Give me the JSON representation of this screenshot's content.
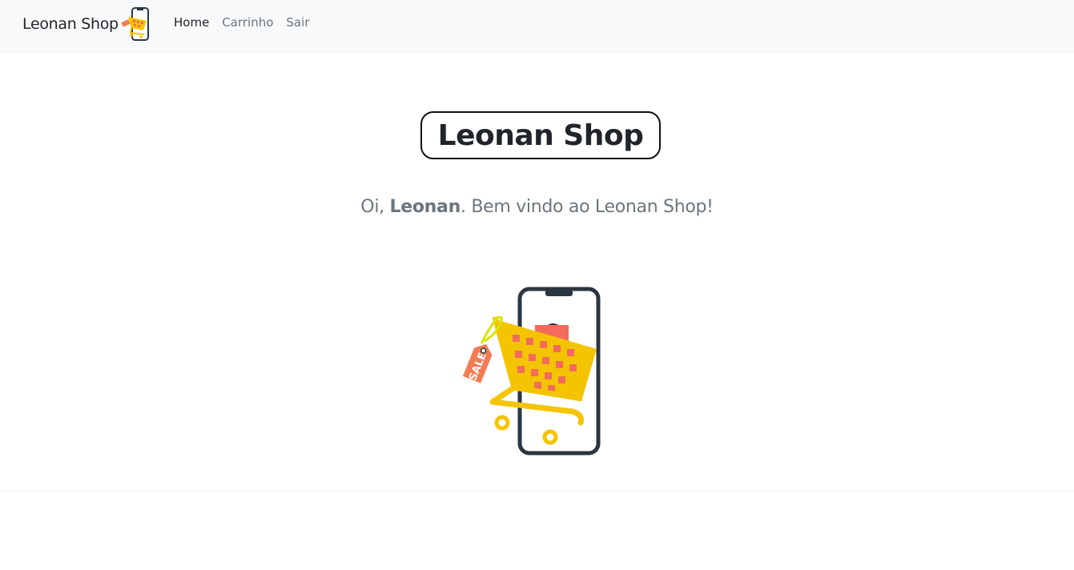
{
  "navbar": {
    "brand": "Leonan Shop",
    "brand_logo_icon": "cart-phone-logo-icon",
    "links": [
      {
        "label": "Home",
        "active": true
      },
      {
        "label": "Carrinho",
        "active": false
      },
      {
        "label": "Sair",
        "active": false
      }
    ]
  },
  "main": {
    "title": "Leonan Shop",
    "greeting_prefix": "Oi, ",
    "user_name": "Leonan",
    "greeting_suffix": ". Bem vindo ao Leonan Shop!",
    "hero": {
      "icon": "shopping-cart-phone-illustration",
      "tag_text": "SALE"
    }
  },
  "colors": {
    "navbar_bg": "#f8f9fa",
    "cart_yellow": "#f5c400",
    "cart_red": "#f26b5b",
    "phone_frame": "#2b3640",
    "tag_orange": "#f47c54",
    "tag_string": "#d6e600"
  }
}
